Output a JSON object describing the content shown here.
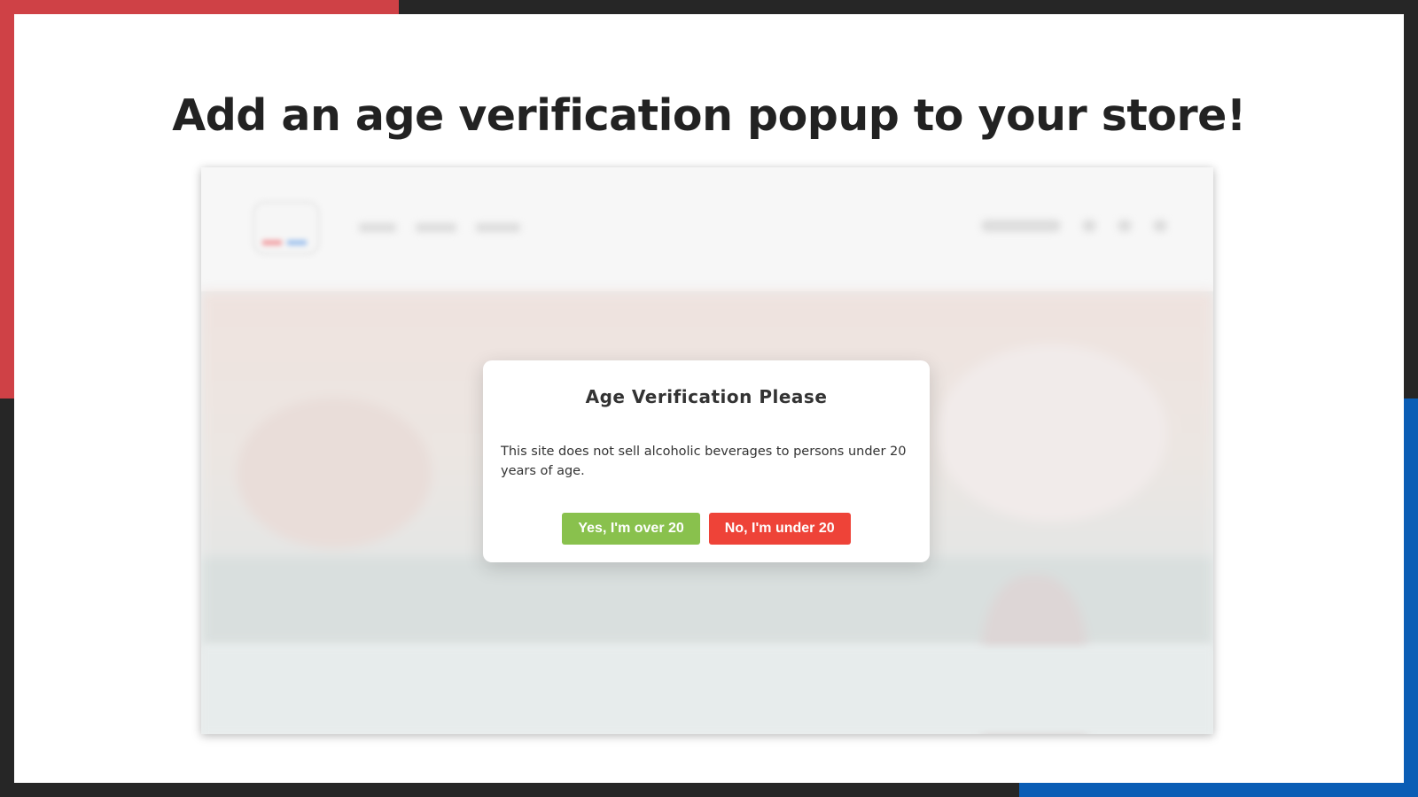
{
  "headline": "Add an age verification popup to your store!",
  "colors": {
    "accent_red": "#cf4146",
    "accent_blue": "#0a5db5",
    "frame": "#262626",
    "confirm_button": "#89c14d",
    "deny_button": "#ee4338"
  },
  "modal": {
    "title": "Age Verification Please",
    "message": "This site does not sell alcoholic beverages to persons under 20 years of age.",
    "confirm_label": "Yes, I'm over 20",
    "deny_label": "No, I'm under 20"
  }
}
